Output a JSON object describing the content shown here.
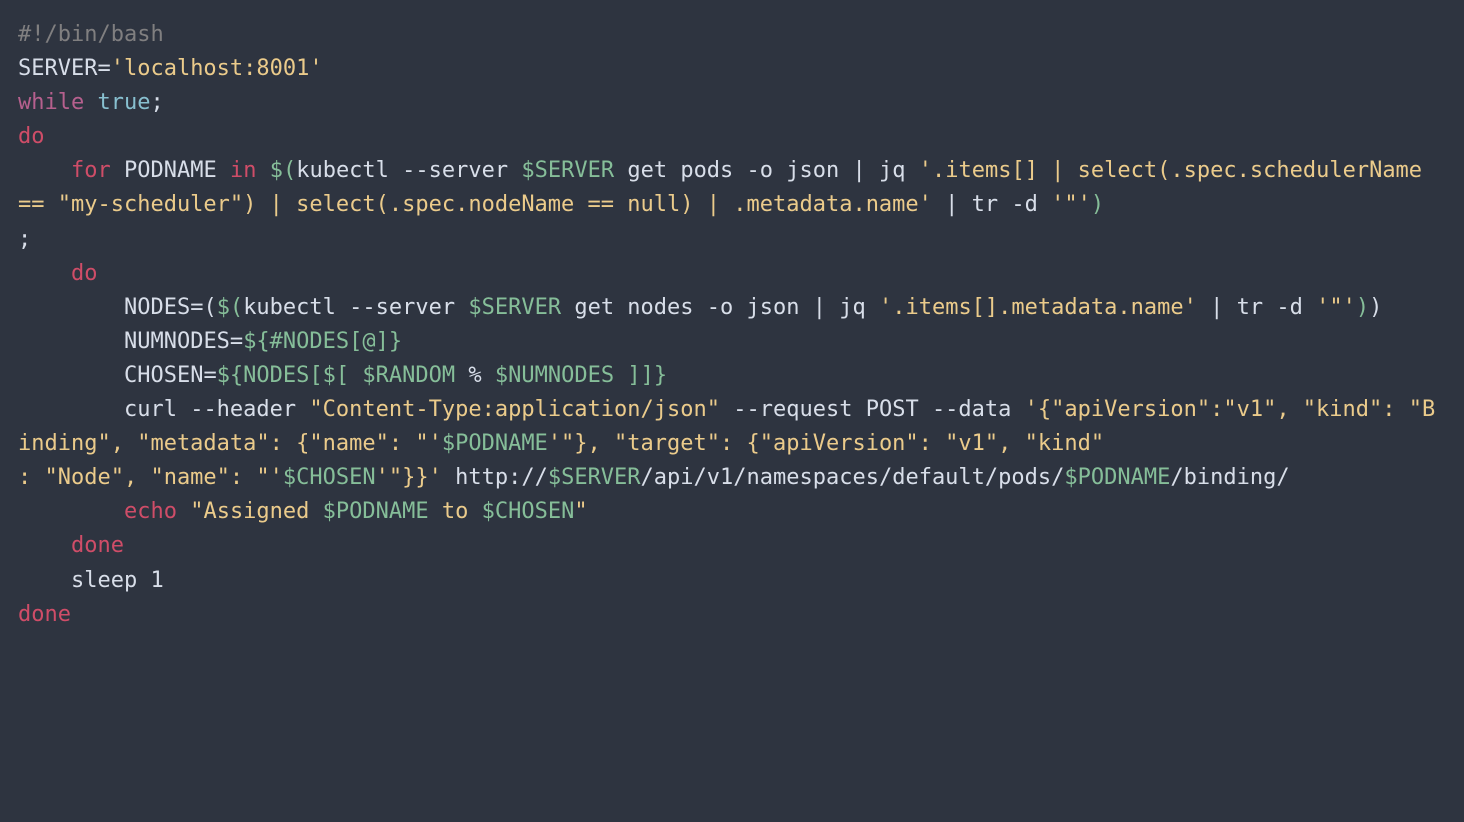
{
  "code": {
    "tokens": [
      {
        "c": "cm",
        "t": "#!/bin/bash"
      },
      {
        "c": "",
        "t": "\n"
      },
      {
        "c": "txt",
        "t": "SERVER="
      },
      {
        "c": "str",
        "t": "'localhost:8001'"
      },
      {
        "c": "",
        "t": "\n"
      },
      {
        "c": "kw",
        "t": "while"
      },
      {
        "c": "txt",
        "t": " "
      },
      {
        "c": "bl",
        "t": "true"
      },
      {
        "c": "txt",
        "t": ";"
      },
      {
        "c": "",
        "t": "\n"
      },
      {
        "c": "kw2",
        "t": "do"
      },
      {
        "c": "",
        "t": "\n"
      },
      {
        "c": "txt",
        "t": "    "
      },
      {
        "c": "kw2",
        "t": "for"
      },
      {
        "c": "txt",
        "t": " PODNAME "
      },
      {
        "c": "kw2",
        "t": "in"
      },
      {
        "c": "txt",
        "t": " "
      },
      {
        "c": "fn",
        "t": "$("
      },
      {
        "c": "txt",
        "t": "kubectl --server "
      },
      {
        "c": "fn",
        "t": "$SERVER"
      },
      {
        "c": "txt",
        "t": " get pods -o json | jq "
      },
      {
        "c": "str",
        "t": "'.items[] | select(.spec.schedulerName == \"my-scheduler\") | select(.spec.nodeName == null) | .metadata.name'"
      },
      {
        "c": "txt",
        "t": " | tr -d "
      },
      {
        "c": "str",
        "t": "'\"'"
      },
      {
        "c": "fn",
        "t": ")"
      },
      {
        "c": "",
        "t": "\n"
      },
      {
        "c": "txt",
        "t": ";"
      },
      {
        "c": "",
        "t": "\n"
      },
      {
        "c": "txt",
        "t": "    "
      },
      {
        "c": "kw2",
        "t": "do"
      },
      {
        "c": "",
        "t": "\n"
      },
      {
        "c": "txt",
        "t": "        NODES=("
      },
      {
        "c": "fn",
        "t": "$("
      },
      {
        "c": "txt",
        "t": "kubectl --server "
      },
      {
        "c": "fn",
        "t": "$SERVER"
      },
      {
        "c": "txt",
        "t": " get nodes -o json | jq "
      },
      {
        "c": "str",
        "t": "'.items[].metadata.name'"
      },
      {
        "c": "txt",
        "t": " | tr -d "
      },
      {
        "c": "str",
        "t": "'\"'"
      },
      {
        "c": "fn",
        "t": ")"
      },
      {
        "c": "txt",
        "t": ")"
      },
      {
        "c": "",
        "t": "\n"
      },
      {
        "c": "txt",
        "t": "        NUMNODES="
      },
      {
        "c": "fn",
        "t": "${#NODES[@]}"
      },
      {
        "c": "",
        "t": "\n"
      },
      {
        "c": "txt",
        "t": "        CHOSEN="
      },
      {
        "c": "fn",
        "t": "${NODES[$["
      },
      {
        "c": "txt",
        "t": " "
      },
      {
        "c": "fn",
        "t": "$RANDOM"
      },
      {
        "c": "txt",
        "t": " % "
      },
      {
        "c": "fn",
        "t": "$NUMNODES"
      },
      {
        "c": "txt",
        "t": " "
      },
      {
        "c": "fn",
        "t": "]]}"
      },
      {
        "c": "",
        "t": "\n"
      },
      {
        "c": "txt",
        "t": "        curl --header "
      },
      {
        "c": "str",
        "t": "\"Content-Type:application/json\""
      },
      {
        "c": "txt",
        "t": " --request POST --data "
      },
      {
        "c": "str",
        "t": "'{\"apiVersion\":\"v1\", \"kind\": \"Binding\", \"metadata\": {\"name\": \"'"
      },
      {
        "c": "fn",
        "t": "$PODNAME"
      },
      {
        "c": "str",
        "t": "'\"}, \"target\": {\"apiVersion\": \"v1\", \"kind\""
      },
      {
        "c": "",
        "t": "\n"
      },
      {
        "c": "str",
        "t": ": \"Node\", \"name\": \"'"
      },
      {
        "c": "fn",
        "t": "$CHOSEN"
      },
      {
        "c": "str",
        "t": "'\"}}'"
      },
      {
        "c": "txt",
        "t": " http://"
      },
      {
        "c": "fn",
        "t": "$SERVER"
      },
      {
        "c": "txt",
        "t": "/api/v1/namespaces/default/pods/"
      },
      {
        "c": "fn",
        "t": "$PODNAME"
      },
      {
        "c": "txt",
        "t": "/binding/"
      },
      {
        "c": "",
        "t": "\n"
      },
      {
        "c": "txt",
        "t": "        "
      },
      {
        "c": "kw2",
        "t": "echo"
      },
      {
        "c": "txt",
        "t": " "
      },
      {
        "c": "str",
        "t": "\"Assigned "
      },
      {
        "c": "fn",
        "t": "$PODNAME"
      },
      {
        "c": "str",
        "t": " to "
      },
      {
        "c": "fn",
        "t": "$CHOSEN"
      },
      {
        "c": "str",
        "t": "\""
      },
      {
        "c": "",
        "t": "\n"
      },
      {
        "c": "txt",
        "t": "    "
      },
      {
        "c": "kw2",
        "t": "done"
      },
      {
        "c": "",
        "t": "\n"
      },
      {
        "c": "txt",
        "t": "    sleep 1"
      },
      {
        "c": "",
        "t": "\n"
      },
      {
        "c": "kw2",
        "t": "done"
      }
    ]
  }
}
